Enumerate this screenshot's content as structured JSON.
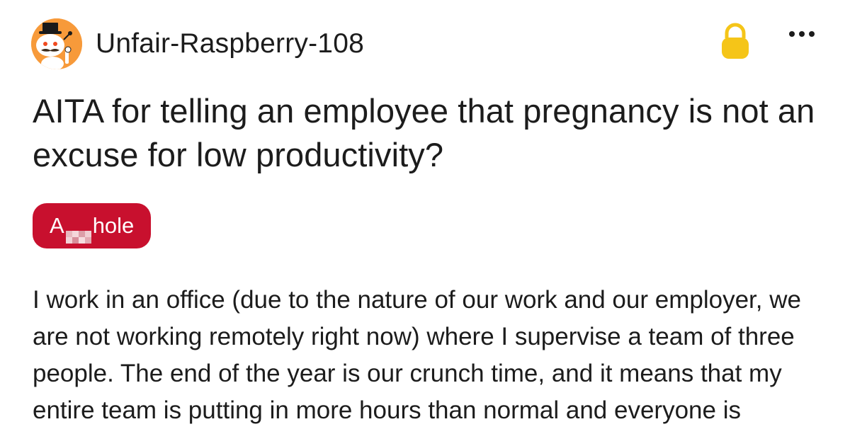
{
  "post": {
    "author": {
      "username": "Unfair-Raspberry-108",
      "avatar_icon": "snoo-avatar-icon"
    },
    "icons": {
      "lock": "lock-icon",
      "more": "more-options-icon"
    },
    "title": "AITA for telling an employee that pregnancy is not an excuse for low productivity?",
    "flair": {
      "prefix": "A",
      "suffix": "hole",
      "color": "#c8102e"
    },
    "body": "I work in an office (due to the nature of our work and our employer, we are not working remotely right now) where I supervise a team of three people. The end of the year is our crunch time, and it means that my entire team is putting in more hours than normal and everyone is"
  },
  "colors": {
    "lock": "#f5c518",
    "avatar": "#f79a3a",
    "text": "#1c1c1c"
  }
}
